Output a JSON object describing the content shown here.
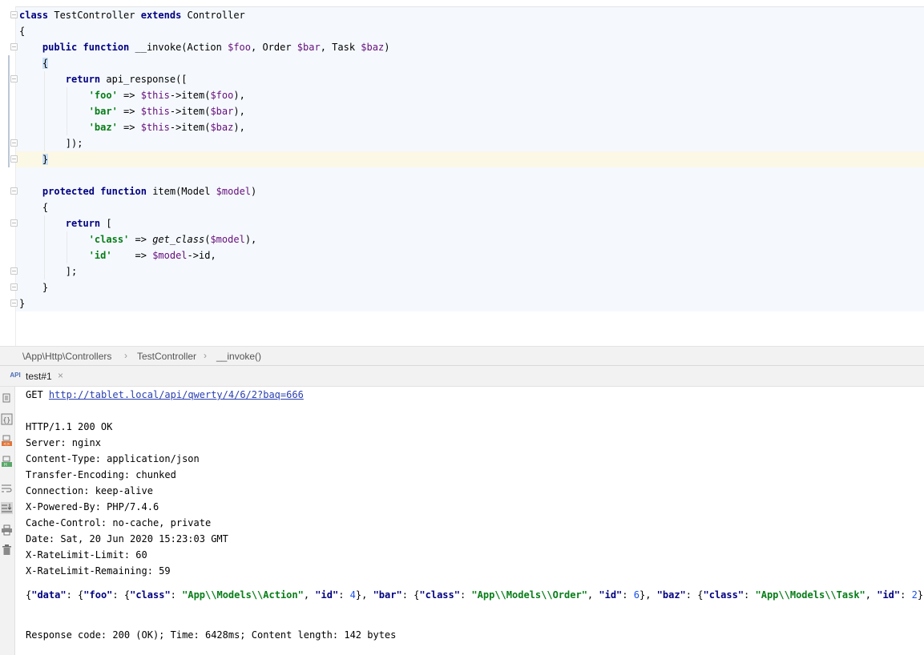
{
  "editor": {
    "lines": [
      [
        {
          "t": "class ",
          "c": "kw"
        },
        {
          "t": "TestController "
        },
        {
          "t": "extends ",
          "c": "kw"
        },
        {
          "t": "Controller"
        }
      ],
      [
        {
          "t": "{"
        }
      ],
      [
        {
          "t": "    "
        },
        {
          "t": "public function ",
          "c": "kw"
        },
        {
          "t": "__invoke(Action "
        },
        {
          "t": "$foo",
          "c": "var"
        },
        {
          "t": ", Order "
        },
        {
          "t": "$bar",
          "c": "var"
        },
        {
          "t": ", Task "
        },
        {
          "t": "$baz",
          "c": "var"
        },
        {
          "t": ")"
        }
      ],
      [
        {
          "t": "    "
        },
        {
          "t": "{",
          "c": "brace-hl"
        }
      ],
      [
        {
          "t": "        "
        },
        {
          "t": "return ",
          "c": "kw"
        },
        {
          "t": "api_response(["
        }
      ],
      [
        {
          "t": "            "
        },
        {
          "t": "'foo'",
          "c": "str"
        },
        {
          "t": " => "
        },
        {
          "t": "$this",
          "c": "var"
        },
        {
          "t": "->item("
        },
        {
          "t": "$foo",
          "c": "var"
        },
        {
          "t": "),"
        }
      ],
      [
        {
          "t": "            "
        },
        {
          "t": "'bar'",
          "c": "str"
        },
        {
          "t": " => "
        },
        {
          "t": "$this",
          "c": "var"
        },
        {
          "t": "->item("
        },
        {
          "t": "$bar",
          "c": "var"
        },
        {
          "t": "),"
        }
      ],
      [
        {
          "t": "            "
        },
        {
          "t": "'baz'",
          "c": "str"
        },
        {
          "t": " => "
        },
        {
          "t": "$this",
          "c": "var"
        },
        {
          "t": "->item("
        },
        {
          "t": "$baz",
          "c": "var"
        },
        {
          "t": "),"
        }
      ],
      [
        {
          "t": "        "
        },
        {
          "t": "]);"
        }
      ],
      [
        {
          "t": "    "
        },
        {
          "t": "}",
          "c": "brace-hl"
        }
      ],
      [
        {
          "t": ""
        }
      ],
      [
        {
          "t": "    "
        },
        {
          "t": "protected function ",
          "c": "kw"
        },
        {
          "t": "item(Model "
        },
        {
          "t": "$model",
          "c": "var"
        },
        {
          "t": ")"
        }
      ],
      [
        {
          "t": "    "
        },
        {
          "t": "{"
        }
      ],
      [
        {
          "t": "        "
        },
        {
          "t": "return ",
          "c": "kw"
        },
        {
          "t": "["
        }
      ],
      [
        {
          "t": "            "
        },
        {
          "t": "'class'",
          "c": "str"
        },
        {
          "t": " => "
        },
        {
          "t": "get_class",
          "c": "fn"
        },
        {
          "t": "("
        },
        {
          "t": "$model",
          "c": "var"
        },
        {
          "t": "),"
        }
      ],
      [
        {
          "t": "            "
        },
        {
          "t": "'id'",
          "c": "str"
        },
        {
          "t": "    => "
        },
        {
          "t": "$model",
          "c": "var"
        },
        {
          "t": "->id,"
        }
      ],
      [
        {
          "t": "        "
        },
        {
          "t": "];"
        }
      ],
      [
        {
          "t": "    "
        },
        {
          "t": "}"
        }
      ],
      [
        {
          "t": "}"
        }
      ]
    ]
  },
  "breadcrumb": {
    "items": [
      "\\App\\Http\\Controllers",
      "TestController",
      "__invoke()"
    ],
    "separator": "›"
  },
  "tool_window": {
    "tab_icon": "API",
    "tab_label": "test#1",
    "tab_close": "×"
  },
  "left_toolbar": {
    "icons": [
      "scroll-to-source-icon",
      "json-view-icon",
      "html-view-icon",
      "headers-view-icon",
      "soft-wrap-icon",
      "scroll-to-end-icon",
      "print-icon",
      "delete-icon"
    ]
  },
  "output": {
    "request_method": "GET",
    "request_url": "http://tablet.local/api/qwerty/4/6/2?baq=666",
    "headers": [
      "HTTP/1.1 200 OK",
      "Server: nginx",
      "Content-Type: application/json",
      "Transfer-Encoding: chunked",
      "Connection: keep-alive",
      "X-Powered-By: PHP/7.4.6",
      "Cache-Control: no-cache, private",
      "Date: Sat, 20 Jun 2020 15:23:03 GMT",
      "X-RateLimit-Limit: 60",
      "X-RateLimit-Remaining: 59"
    ],
    "body": [
      {
        "t": "{",
        "c": ""
      },
      {
        "t": "\"data\"",
        "c": "jkey"
      },
      {
        "t": ": {",
        "c": ""
      },
      {
        "t": "\"foo\"",
        "c": "jkey"
      },
      {
        "t": ": {",
        "c": ""
      },
      {
        "t": "\"class\"",
        "c": "jkey"
      },
      {
        "t": ": ",
        "c": ""
      },
      {
        "t": "\"App\\\\Models\\\\Action\"",
        "c": "jstr"
      },
      {
        "t": ", ",
        "c": ""
      },
      {
        "t": "\"id\"",
        "c": "jkey"
      },
      {
        "t": ": ",
        "c": ""
      },
      {
        "t": "4",
        "c": "jnum"
      },
      {
        "t": "}, ",
        "c": ""
      },
      {
        "t": "\"bar\"",
        "c": "jkey"
      },
      {
        "t": ": {",
        "c": ""
      },
      {
        "t": "\"class\"",
        "c": "jkey"
      },
      {
        "t": ": ",
        "c": ""
      },
      {
        "t": "\"App\\\\Models\\\\Order\"",
        "c": "jstr"
      },
      {
        "t": ", ",
        "c": ""
      },
      {
        "t": "\"id\"",
        "c": "jkey"
      },
      {
        "t": ": ",
        "c": ""
      },
      {
        "t": "6",
        "c": "jnum"
      },
      {
        "t": "}, ",
        "c": ""
      },
      {
        "t": "\"baz\"",
        "c": "jkey"
      },
      {
        "t": ": {",
        "c": ""
      },
      {
        "t": "\"class\"",
        "c": "jkey"
      },
      {
        "t": ": ",
        "c": ""
      },
      {
        "t": "\"App\\\\Models\\\\Task\"",
        "c": "jstr"
      },
      {
        "t": ", ",
        "c": ""
      },
      {
        "t": "\"id\"",
        "c": "jkey"
      },
      {
        "t": ": ",
        "c": ""
      },
      {
        "t": "2",
        "c": "jnum"
      },
      {
        "t": "}}}",
        "c": ""
      }
    ],
    "summary": "Response code: 200 (OK); Time: 6428ms; Content length: 142 bytes"
  },
  "colors": {
    "keyword": "#000080",
    "variable": "#660e7a",
    "string": "#067d17",
    "number": "#1750eb",
    "link": "#2a3fb0",
    "caret_line": "#fcf8e6",
    "editor_scope": "#f5f9fe"
  }
}
